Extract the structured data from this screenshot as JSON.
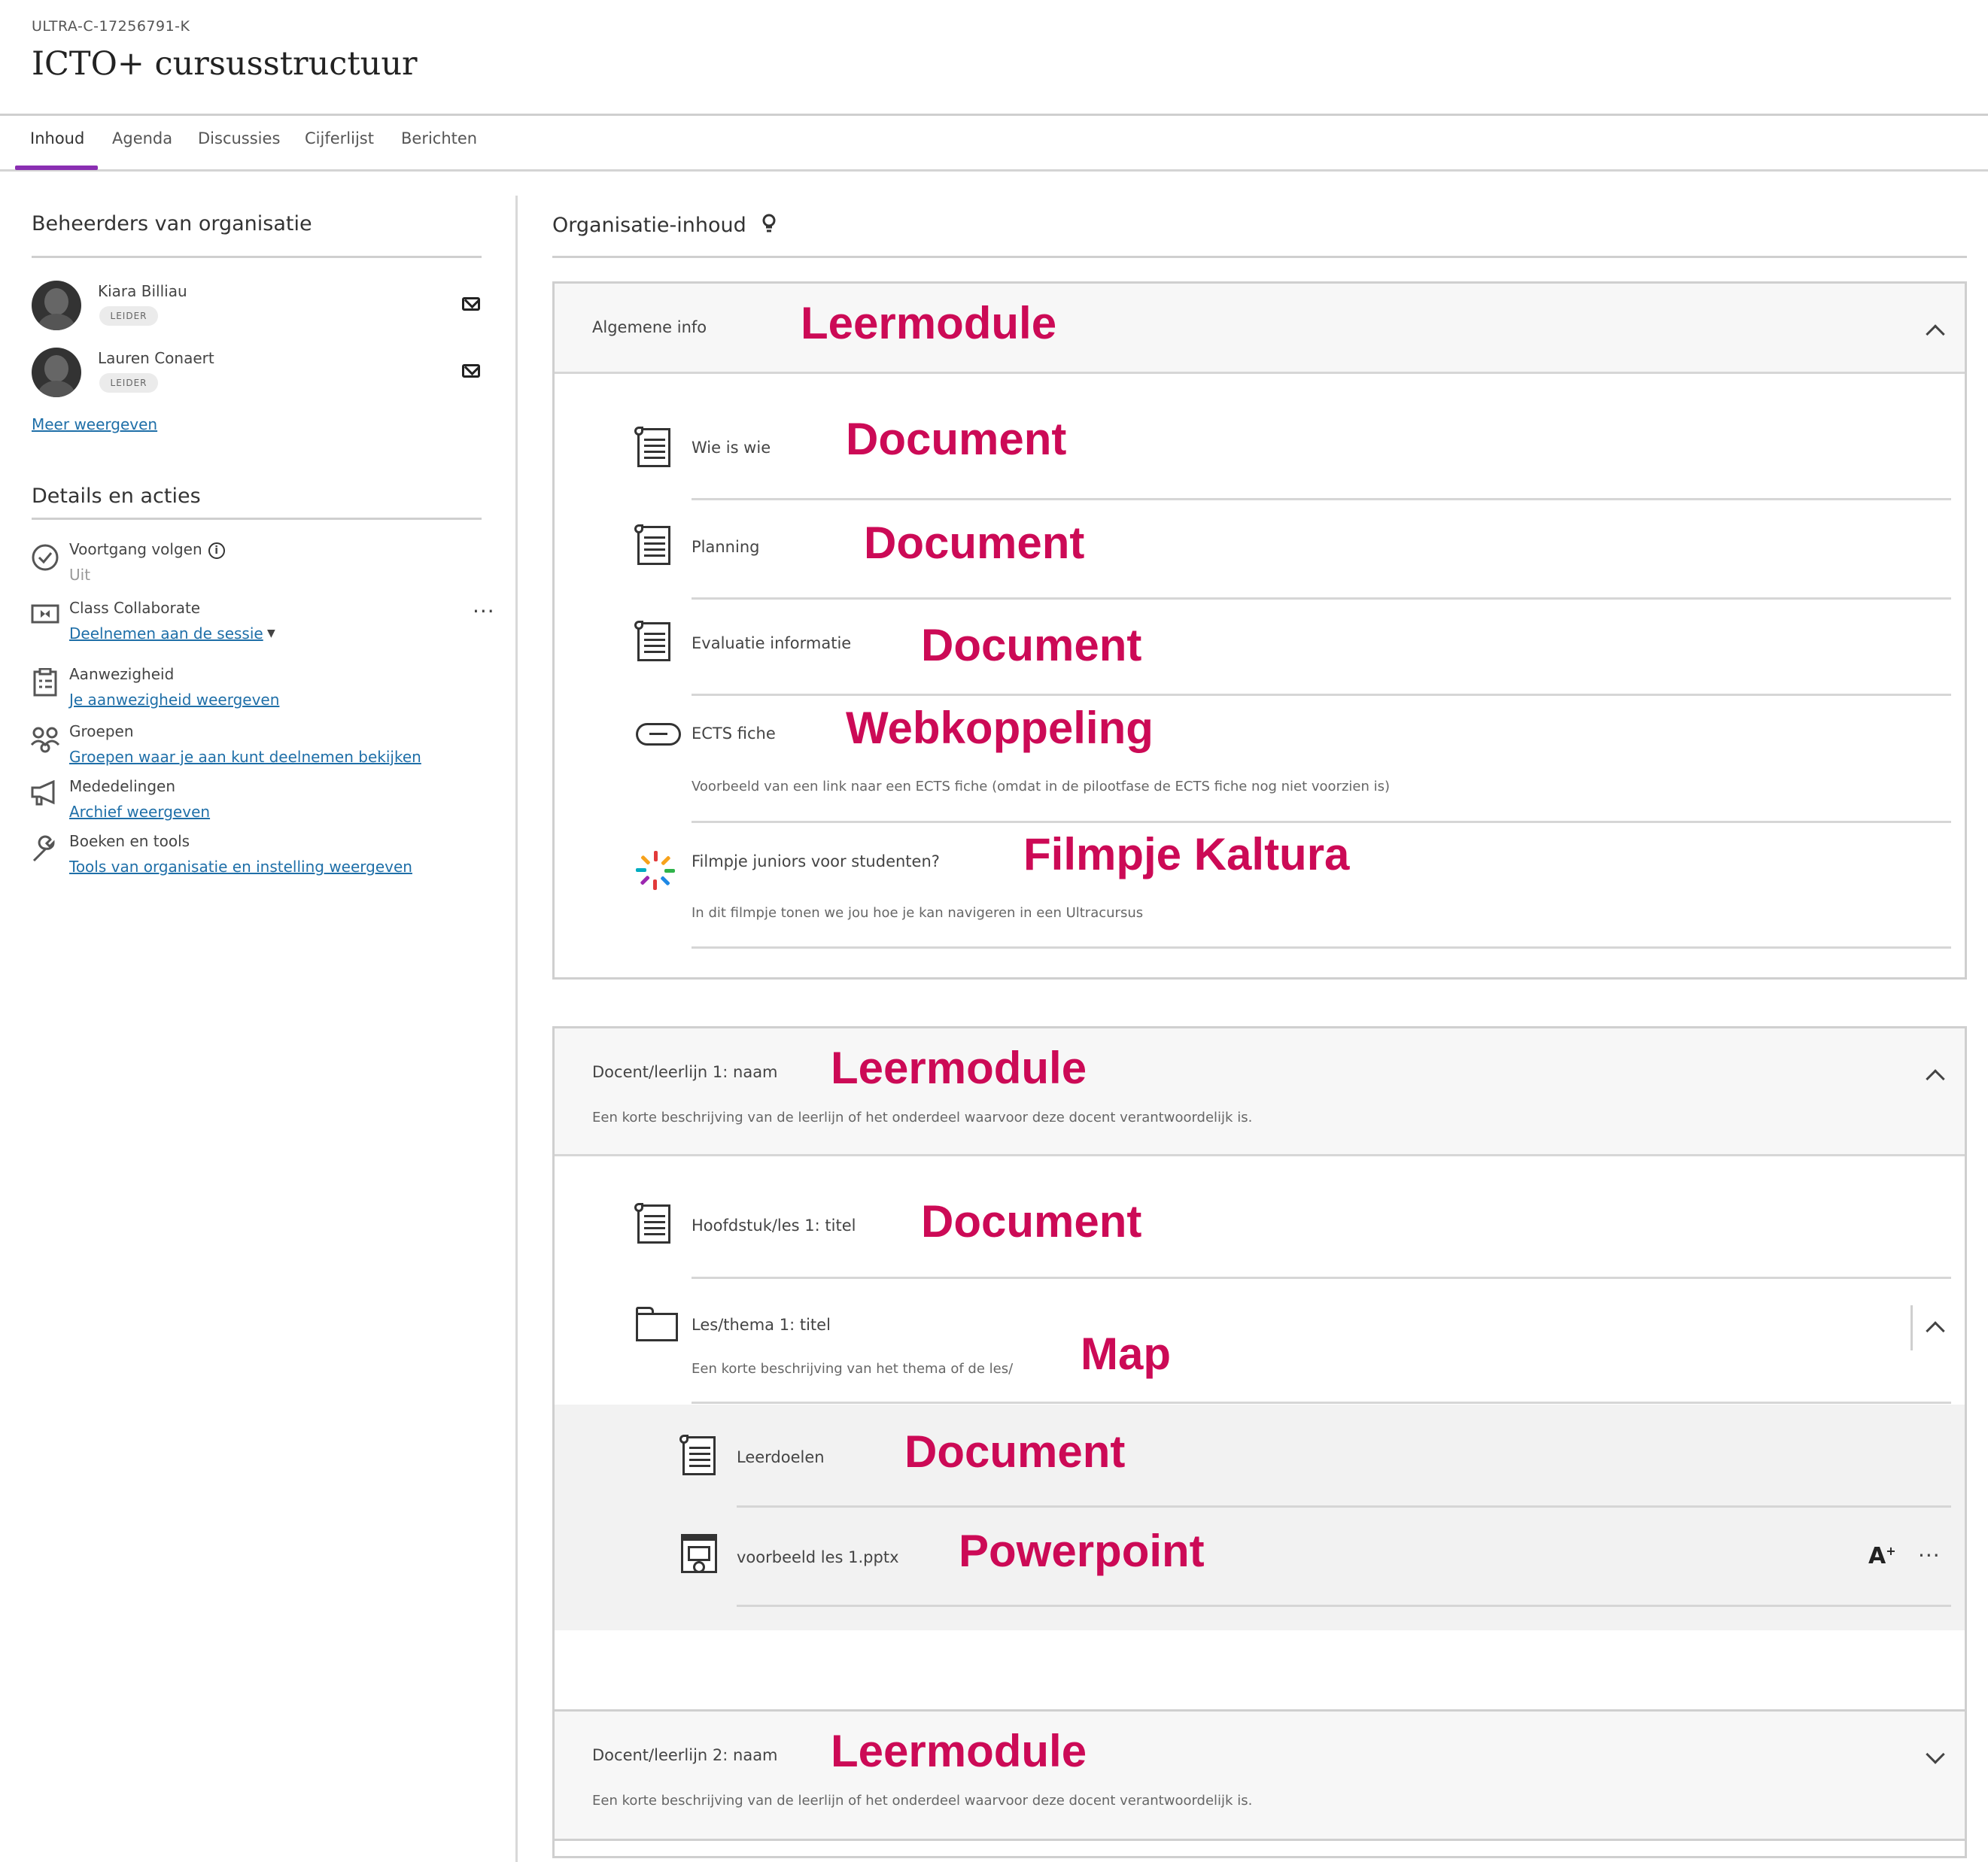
{
  "course": {
    "id": "ULTRA-C-17256791-K",
    "title": "ICTO+ cursusstructuur"
  },
  "tabs": [
    "Inhoud",
    "Agenda",
    "Discussies",
    "Cijferlijst",
    "Berichten"
  ],
  "sidebar": {
    "admins_title": "Beheerders van organisatie",
    "admins": [
      {
        "name": "Kiara Billiau",
        "role": "LEIDER"
      },
      {
        "name": "Lauren Conaert",
        "role": "LEIDER"
      }
    ],
    "more_link": "Meer weergeven",
    "details_title": "Details en acties",
    "details": [
      {
        "icon": "check-circle-icon",
        "label": "Voortgang volgen",
        "sub": "Uit"
      },
      {
        "icon": "video-icon",
        "label": "Class Collaborate",
        "sub": "Deelnemen aan de sessie"
      },
      {
        "icon": "clipboard-icon",
        "label": "Aanwezigheid",
        "sub": "Je aanwezigheid weergeven"
      },
      {
        "icon": "groups-icon",
        "label": "Groepen",
        "sub": "Groepen waar je aan kunt deelnemen bekijken"
      },
      {
        "icon": "megaphone-icon",
        "label": "Mededelingen",
        "sub": "Archief weergeven"
      },
      {
        "icon": "wrench-icon",
        "label": "Boeken en tools",
        "sub": "Tools van organisatie en instelling weergeven"
      }
    ]
  },
  "main": {
    "title": "Organisatie-inhoud",
    "modules": [
      {
        "title": "Algemene info",
        "annotation": "Leermodule",
        "items": [
          {
            "type": "document",
            "title": "Wie is wie",
            "annotation": "Document"
          },
          {
            "type": "document",
            "title": "Planning",
            "annotation": "Document"
          },
          {
            "type": "document",
            "title": "Evaluatie informatie",
            "annotation": "Document"
          },
          {
            "type": "link",
            "title": "ECTS fiche",
            "annotation": "Webkoppeling",
            "desc": "Voorbeeld van een link naar een ECTS fiche (omdat in de pilootfase de ECTS fiche nog niet voorzien is)"
          },
          {
            "type": "kaltura",
            "title": "Filmpje juniors voor studenten?",
            "annotation": "Filmpje Kaltura",
            "desc": "In dit filmpje tonen we jou hoe je kan navigeren in een Ultracursus"
          }
        ]
      },
      {
        "title": "Docent/leerlijn 1: naam",
        "annotation": "Leermodule",
        "desc": "Een korte beschrijving van de leerlijn of het onderdeel waarvoor deze docent verantwoordelijk is.",
        "items": [
          {
            "type": "document",
            "title": "Hoofdstuk/les 1: titel",
            "annotation": "Document"
          },
          {
            "type": "folder",
            "title": "Les/thema 1: titel",
            "annotation": "Map",
            "desc": "Een korte beschrijving van het thema of de les/"
          }
        ],
        "folder_items": [
          {
            "type": "document",
            "title": "Leerdoelen",
            "annotation": "Document"
          },
          {
            "type": "powerpoint",
            "title": "voorbeeld les 1.pptx",
            "annotation": "Powerpoint"
          }
        ]
      },
      {
        "title": "Docent/leerlijn 2: naam",
        "annotation": "Leermodule",
        "desc": "Een korte beschrijving van de leerlijn of het onderdeel waarvoor deze docent verantwoordelijk is."
      }
    ]
  },
  "colors": {
    "accent": "#8a2fb2",
    "annotation": "#cc0a56",
    "link": "#1f6fa8"
  }
}
